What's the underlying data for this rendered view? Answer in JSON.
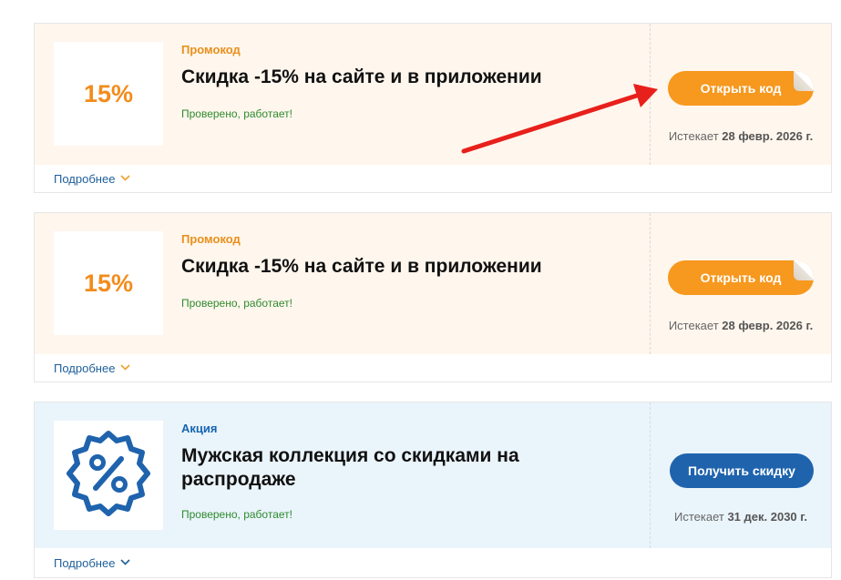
{
  "cards": [
    {
      "logo_text": "15%",
      "kind": "Промокод",
      "title": "Скидка -15% на сайте и в приложении",
      "verified": "Проверено, работает!",
      "button_label": "Открыть код",
      "expires_prefix": "Истекает ",
      "expires_date": "28 февр. 2026 г.",
      "details_label": "Подробнее"
    },
    {
      "logo_text": "15%",
      "kind": "Промокод",
      "title": "Скидка -15% на сайте и в приложении",
      "verified": "Проверено, работает!",
      "button_label": "Открыть код",
      "expires_prefix": "Истекает ",
      "expires_date": "28 февр. 2026 г.",
      "details_label": "Подробнее"
    },
    {
      "logo_icon": "percent-badge-icon",
      "kind": "Акция",
      "title": "Мужская коллекция со скидками на распродаже",
      "verified": "Проверено, работает!",
      "button_label": "Получить скидку",
      "expires_prefix": "Истекает ",
      "expires_date": "31 дек. 2030 г.",
      "details_label": "Подробнее"
    }
  ],
  "colors": {
    "promo_bg": "#fff6ed",
    "deal_bg": "#eaf4fb",
    "orange_button": "#f7981f",
    "blue_button": "#1f63ad",
    "annotation_arrow": "#e8201c"
  },
  "chevron_icon": "chevron-down-icon",
  "annotation": "red-arrow-icon"
}
